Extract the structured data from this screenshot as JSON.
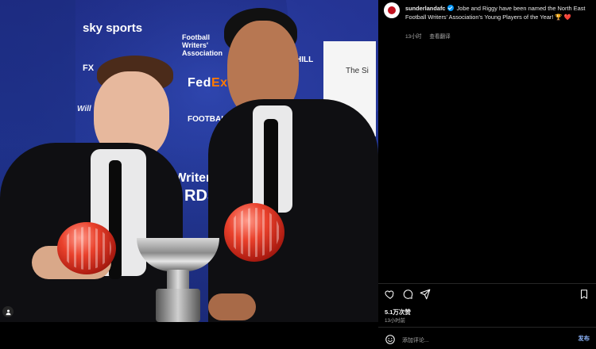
{
  "post": {
    "username": "sunderlandafc",
    "caption_text": "Jobe and Riggy have been named the North East Football Writers' Association's Young Players of the Year! 🏆 ❤️",
    "time_ago": "13小时",
    "translate": "查看翻译",
    "likes": "5.1万次赞",
    "footer_time": "13小时前",
    "comment_placeholder": "添加评论...",
    "post_button": "发布"
  },
  "media": {
    "brand_logos": {
      "sky": "sky sports",
      "fwa": "Football Writers' Association",
      "fedex_left": "Fed",
      "fedex_right": "Ex.",
      "fm": "FOOTBALL MANAGER",
      "fx": "FX",
      "will": "Will",
      "hill": "HILL",
      "writers": "ll Writers",
      "awards": "RDS",
      "sign": "The Si"
    }
  },
  "colors": {
    "background": "#000000",
    "backdrop_blue": "#223695",
    "verified": "#0095f6",
    "accent_red": "#c1121f",
    "muted": "#a8a8a8"
  }
}
